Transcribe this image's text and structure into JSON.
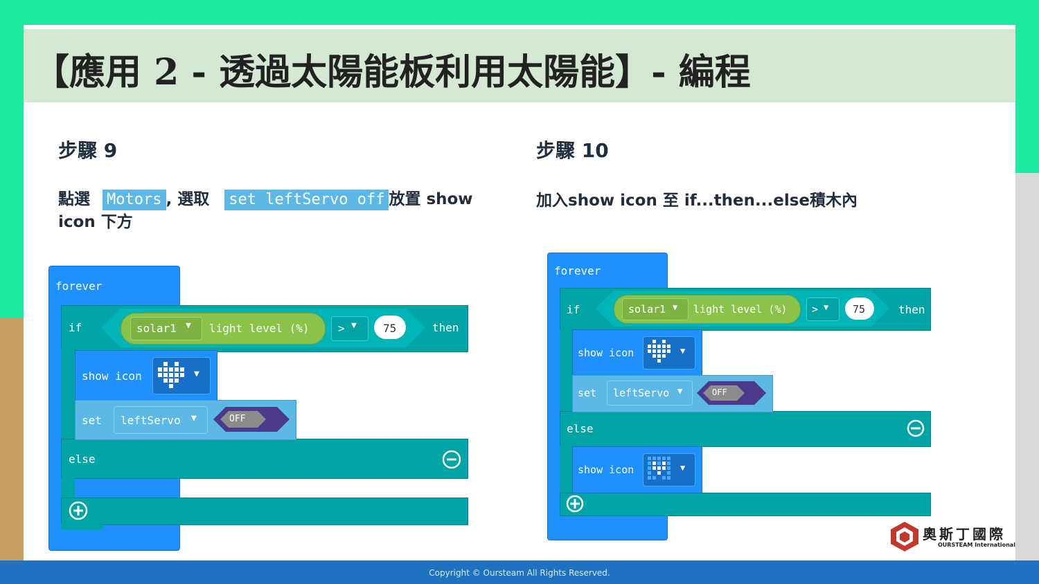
{
  "slide": {
    "title": "【應用 2 - 透過太陽能板利用太陽能】- 編程",
    "copyright": "Copyright © Oursteam All Rights Reserved.",
    "logo": {
      "name_cn": "奧斯丁國際",
      "name_en": "OURSTEAM International"
    }
  },
  "step9": {
    "heading": "步驟 9",
    "desc_pre": "點選",
    "chip1": "Motors",
    "desc_mid": ", 選取",
    "chip2": "set leftServo off",
    "desc_post": "放置 show icon 下方"
  },
  "step10": {
    "heading": "步驟 10",
    "desc": "加入show icon 至 if...then...else積木內"
  },
  "blocks": {
    "forever": "forever",
    "if": "if",
    "then": "then",
    "else": "else",
    "sensor": "solar1",
    "light_level": "light level (%)",
    "operator": ">",
    "threshold": "75",
    "show_icon": "show icon",
    "set": "set",
    "servo": "leftServo",
    "off": "OFF"
  },
  "colors": {
    "forever": "#1e90ff",
    "logic": "#00a4a6",
    "basic": "#1e90ff",
    "motors": "#5cb8e6",
    "sensor": "#8ac34a",
    "value": "#4b3a8c",
    "title_bar": "#d5e8d4",
    "footer": "#1e72c0"
  }
}
